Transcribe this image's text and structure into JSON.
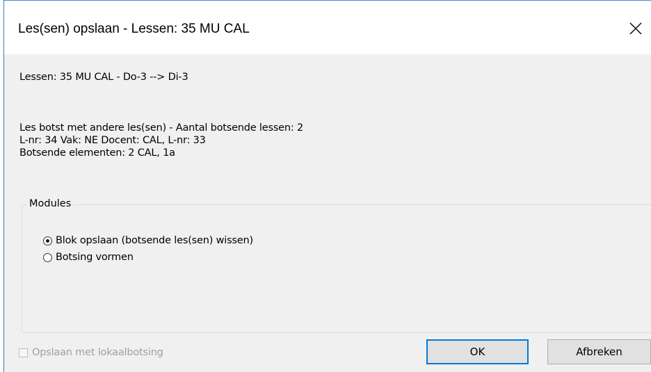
{
  "window": {
    "title": "Les(sen) opslaan - Lessen: 35 MU CAL",
    "close_icon": "close-icon"
  },
  "content": {
    "header_line": "Lessen: 35 MU CAL - Do-3 --> Di-3",
    "conflict_lines": [
      "Les botst met andere les(sen) - Aantal botsende lessen: 2",
      "L-nr: 34 Vak: NE Docent: CAL, L-nr: 33",
      "Botsende elementen: 2 CAL, 1a"
    ]
  },
  "modules_group": {
    "legend": "Modules",
    "options": [
      {
        "label": "Blok opslaan (botsende les(sen) wissen)",
        "selected": true
      },
      {
        "label": "Botsing vormen",
        "selected": false
      }
    ]
  },
  "footer": {
    "checkbox_label": "Opslaan met lokaalbotsing",
    "checkbox_checked": false,
    "checkbox_enabled": false,
    "ok_label": "OK",
    "cancel_label": "Afbreken"
  },
  "colors": {
    "titlebar_bg": "#ffffff",
    "client_bg": "#f0f0f0",
    "window_border": "#3c78c8",
    "default_button_border": "#0078d7",
    "disabled_text": "#a0a0a0"
  }
}
